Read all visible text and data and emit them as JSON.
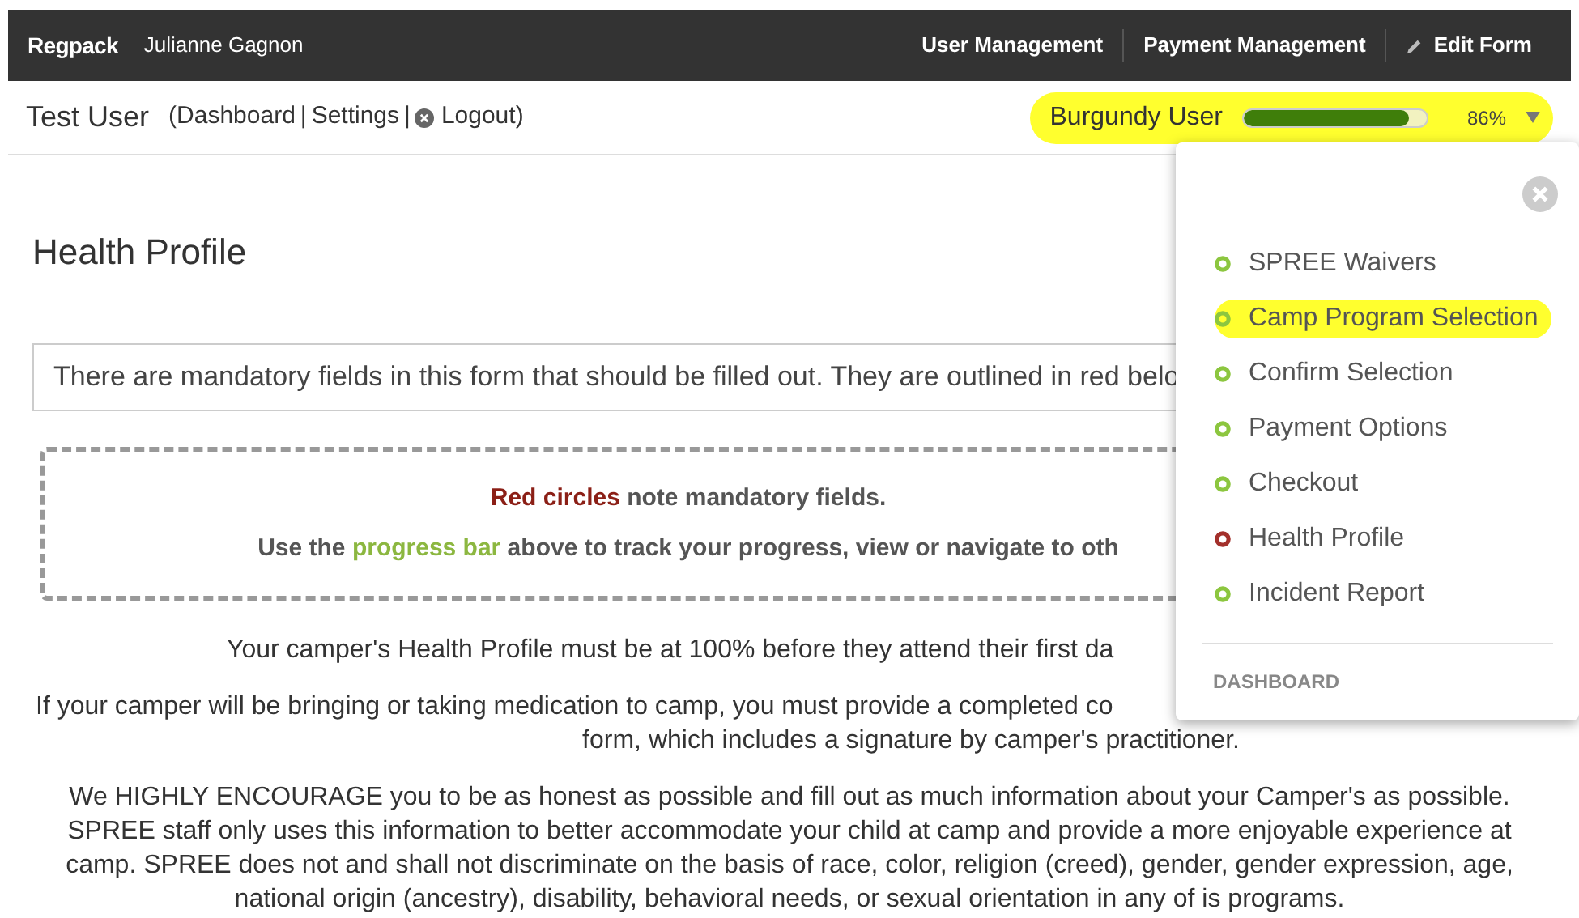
{
  "topbar": {
    "logo": "Regpack",
    "account": "Julianne Gagnon",
    "links": [
      {
        "label": "User Management",
        "kind": "text"
      },
      {
        "label": "Payment Management",
        "kind": "text"
      },
      {
        "label": "Edit Form",
        "kind": "pencil"
      }
    ]
  },
  "userbar": {
    "user": "Test User",
    "open": "(",
    "links": [
      {
        "label": "Dashboard",
        "kind": "text"
      },
      {
        "label": "|",
        "kind": "separator"
      },
      {
        "label": "Settings",
        "kind": "text"
      },
      {
        "label": "|",
        "kind": "separator"
      },
      {
        "label": "Logout",
        "kind": "logout"
      }
    ],
    "close": ")",
    "participant": "Burgundy User",
    "highlighted": true,
    "level": 0.9,
    "percent": "86%"
  },
  "page": {
    "title": "Health Profile",
    "notice": "There are mandatory fields in this form that should be filled out. They are outlined in red belo",
    "legend": [
      "**Red circles** note mandatory fields.",
      "Use the *progress bar* above to track your progress, view or navigate to oth"
    ],
    "paragraphs": [
      {
        "lines": [
          "Your camper's Health Profile must be at 100% before they attend their first da"
        ]
      },
      {
        "lines": [
          "If your camper will be bringing or taking medication to camp, you must provide a completed co",
          "form, which includes a signature by camper's practitioner."
        ]
      },
      {
        "lines": [
          "We HIGHLY ENCOURAGE you to be as honest as possible and fill out as much information about your Camper's as possible. SPREE staff only uses this information to better accommodate your child at camp and provide a more enjoyable experience at camp. SPREE does not and shall not discriminate on the basis of race, color, religion (creed), gender, gender expression, age, national origin (ancestry), disability, behavioral needs, or sexual orientation in any of is programs."
        ]
      }
    ]
  },
  "dropdown": {
    "items": [
      {
        "label": "SPREE Waivers",
        "color": "#8cc63f",
        "highlighted": false
      },
      {
        "label": "Camp Program Selection",
        "color": "#8cc63f",
        "highlighted": true
      },
      {
        "label": "Confirm Selection",
        "color": "#8cc63f",
        "highlighted": false
      },
      {
        "label": "Payment Options",
        "color": "#8cc63f",
        "highlighted": false
      },
      {
        "label": "Checkout",
        "color": "#8cc63f",
        "highlighted": false
      },
      {
        "label": "Health Profile",
        "color": "#a3302b",
        "highlighted": false
      },
      {
        "label": "Incident Report",
        "color": "#8cc63f",
        "highlighted": false
      }
    ],
    "footer": "DASHBOARD"
  }
}
